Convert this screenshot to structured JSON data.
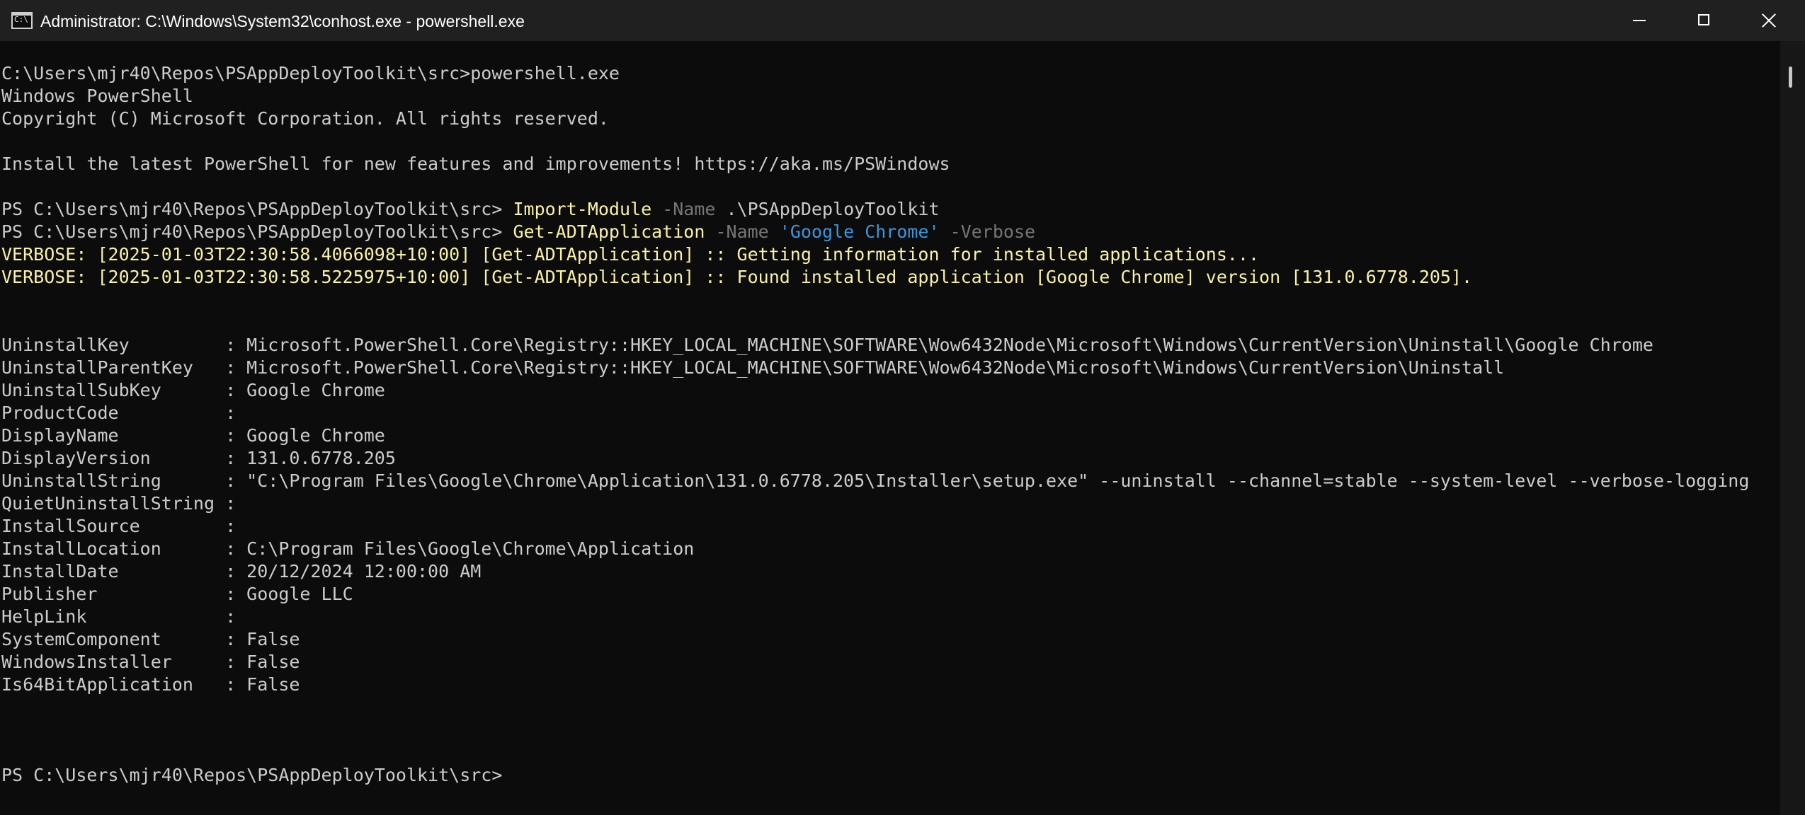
{
  "window": {
    "title": "Administrator: C:\\Windows\\System32\\conhost.exe - powershell.exe",
    "icon": "console-window-icon",
    "icon_label": "C:\\"
  },
  "controls": {
    "minimize": "minimize-icon",
    "maximize": "maximize-icon",
    "close": "close-icon"
  },
  "colors": {
    "background": "#0c0c0c",
    "text": "#cccccc",
    "command": "#f9f1a5",
    "parameter": "#767676",
    "string": "#3a96dd",
    "verbose": "#f9f1a5"
  },
  "console": {
    "lines": [
      {
        "segments": [
          {
            "t": "C:\\Users\\mjr40\\Repos\\PSAppDeployToolkit\\src>powershell.exe",
            "c": "plain"
          }
        ]
      },
      {
        "segments": [
          {
            "t": "Windows PowerShell",
            "c": "plain"
          }
        ]
      },
      {
        "segments": [
          {
            "t": "Copyright (C) Microsoft Corporation. All rights reserved.",
            "c": "plain"
          }
        ]
      },
      {
        "segments": []
      },
      {
        "segments": [
          {
            "t": "Install the latest PowerShell for new features and improvements! https://aka.ms/PSWindows",
            "c": "plain"
          }
        ]
      },
      {
        "segments": []
      },
      {
        "segments": [
          {
            "t": "PS C:\\Users\\mjr40\\Repos\\PSAppDeployToolkit\\src> ",
            "c": "plain"
          },
          {
            "t": "Import-Module",
            "c": "cmd"
          },
          {
            "t": " ",
            "c": "plain"
          },
          {
            "t": "-Name",
            "c": "param"
          },
          {
            "t": " .\\PSAppDeployToolkit",
            "c": "plain"
          }
        ]
      },
      {
        "segments": [
          {
            "t": "PS C:\\Users\\mjr40\\Repos\\PSAppDeployToolkit\\src> ",
            "c": "plain"
          },
          {
            "t": "Get-ADTApplication",
            "c": "cmd"
          },
          {
            "t": " ",
            "c": "plain"
          },
          {
            "t": "-Name",
            "c": "param"
          },
          {
            "t": " ",
            "c": "plain"
          },
          {
            "t": "'Google Chrome'",
            "c": "str"
          },
          {
            "t": " ",
            "c": "plain"
          },
          {
            "t": "-Verbose",
            "c": "param"
          }
        ]
      },
      {
        "segments": [
          {
            "t": "VERBOSE: [2025-01-03T22:30:58.4066098+10:00] [Get-ADTApplication] :: Getting information for installed applications...",
            "c": "verbose"
          }
        ]
      },
      {
        "segments": [
          {
            "t": "VERBOSE: [2025-01-03T22:30:58.5225975+10:00] [Get-ADTApplication] :: Found installed application [Google Chrome] version [131.0.6778.205].",
            "c": "verbose"
          }
        ]
      },
      {
        "segments": []
      },
      {
        "segments": []
      },
      {
        "segments": [
          {
            "t": "UninstallKey         : Microsoft.PowerShell.Core\\Registry::HKEY_LOCAL_MACHINE\\SOFTWARE\\Wow6432Node\\Microsoft\\Windows\\CurrentVersion\\Uninstall\\Google Chrome",
            "c": "plain"
          }
        ]
      },
      {
        "segments": [
          {
            "t": "UninstallParentKey   : Microsoft.PowerShell.Core\\Registry::HKEY_LOCAL_MACHINE\\SOFTWARE\\Wow6432Node\\Microsoft\\Windows\\CurrentVersion\\Uninstall",
            "c": "plain"
          }
        ]
      },
      {
        "segments": [
          {
            "t": "UninstallSubKey      : Google Chrome",
            "c": "plain"
          }
        ]
      },
      {
        "segments": [
          {
            "t": "ProductCode          :",
            "c": "plain"
          }
        ]
      },
      {
        "segments": [
          {
            "t": "DisplayName          : Google Chrome",
            "c": "plain"
          }
        ]
      },
      {
        "segments": [
          {
            "t": "DisplayVersion       : 131.0.6778.205",
            "c": "plain"
          }
        ]
      },
      {
        "segments": [
          {
            "t": "UninstallString      : \"C:\\Program Files\\Google\\Chrome\\Application\\131.0.6778.205\\Installer\\setup.exe\" --uninstall --channel=stable --system-level --verbose-logging",
            "c": "plain"
          }
        ]
      },
      {
        "segments": [
          {
            "t": "QuietUninstallString :",
            "c": "plain"
          }
        ]
      },
      {
        "segments": [
          {
            "t": "InstallSource        :",
            "c": "plain"
          }
        ]
      },
      {
        "segments": [
          {
            "t": "InstallLocation      : C:\\Program Files\\Google\\Chrome\\Application",
            "c": "plain"
          }
        ]
      },
      {
        "segments": [
          {
            "t": "InstallDate          : 20/12/2024 12:00:00 AM",
            "c": "plain"
          }
        ]
      },
      {
        "segments": [
          {
            "t": "Publisher            : Google LLC",
            "c": "plain"
          }
        ]
      },
      {
        "segments": [
          {
            "t": "HelpLink             :",
            "c": "plain"
          }
        ]
      },
      {
        "segments": [
          {
            "t": "SystemComponent      : False",
            "c": "plain"
          }
        ]
      },
      {
        "segments": [
          {
            "t": "WindowsInstaller     : False",
            "c": "plain"
          }
        ]
      },
      {
        "segments": [
          {
            "t": "Is64BitApplication   : False",
            "c": "plain"
          }
        ]
      },
      {
        "segments": []
      },
      {
        "segments": []
      },
      {
        "segments": []
      },
      {
        "segments": [
          {
            "t": "PS C:\\Users\\mjr40\\Repos\\PSAppDeployToolkit\\src> ",
            "c": "plain"
          }
        ]
      }
    ]
  }
}
